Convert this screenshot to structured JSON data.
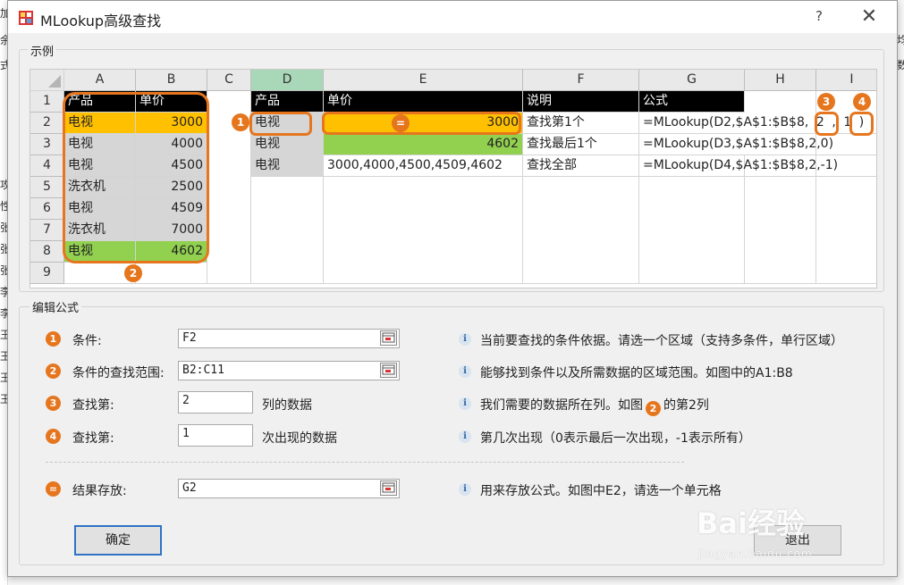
{
  "window": {
    "title": "MLookup高级查找",
    "help": "?",
    "close": "✕"
  },
  "background": {
    "left_chars": [
      "加",
      "余",
      "式",
      "",
      "",
      "",
      "",
      "",
      "攻",
      "性",
      "张",
      "张",
      "张",
      "李",
      "李",
      "王",
      "王",
      "王",
      "王"
    ],
    "right_chars": [
      "均",
      "数"
    ]
  },
  "example_group": {
    "legend": "示例"
  },
  "sheet": {
    "col_headers": [
      "A",
      "B",
      "C",
      "D",
      "E",
      "F",
      "G",
      "H",
      "I"
    ],
    "row_headers": [
      "1",
      "2",
      "3",
      "4",
      "5",
      "6",
      "7",
      "8",
      "9"
    ],
    "cells": {
      "A1": "产品",
      "B1": "单价",
      "A2": "电视",
      "B2": "3000",
      "A3": "电视",
      "B3": "4000",
      "A4": "电视",
      "B4": "4500",
      "A5": "洗衣机",
      "B5": "2500",
      "A6": "电视",
      "B6": "4509",
      "A7": "洗衣机",
      "B7": "7000",
      "A8": "电视",
      "B8": "4602",
      "D1": "产品",
      "E1": "单价",
      "F1": "说明",
      "G1": "公式",
      "D2": "电视",
      "E2": "3000",
      "F2": "查找第1个",
      "G2": "=MLookup(D2,$A$1:$B$8,2,1)",
      "D3": "电视",
      "E3": "4602",
      "F3": "查找最后1个",
      "G3": "=MLookup(D3,$A$1:$B$8,2,0)",
      "D4": "电视",
      "E4": "3000,4000,4500,4509,4602",
      "F4": "查找全部",
      "G4": "=MLookup(D4,$A$1:$B$8,2,-1)",
      "G2_prefix": "=MLookup(D2,$A$1:$B$8,",
      "G2_arg3": "2",
      "G2_comma": ",",
      "G2_arg4": "1",
      "G2_close": ")"
    },
    "badges": {
      "b1": "1",
      "b2": "2",
      "b3": "3",
      "b4": "4",
      "eq": "="
    }
  },
  "edit_group": {
    "legend": "编辑公式"
  },
  "form": {
    "rows": [
      {
        "badge": "1",
        "label": "条件:",
        "value": "F2",
        "info": "当前要查找的条件依据。请选一个区域（支持多条件，单行区域）"
      },
      {
        "badge": "2",
        "label": "条件的查找范围:",
        "value": "B2:C11",
        "info": "能够找到条件以及所需数据的区域范围。如图中的A1:B8"
      },
      {
        "badge": "3",
        "label": "查找第:",
        "value": "2",
        "suffix": "列的数据",
        "info_a": "我们需要的数据所在列。如图",
        "info_badge": "2",
        "info_b": "的第2列"
      },
      {
        "badge": "4",
        "label": "查找第:",
        "value": "1",
        "suffix": "次出现的数据",
        "info": "第几次出现（0表示最后一次出现，-1表示所有）"
      },
      {
        "badge": "=",
        "label": "结果存放:",
        "value": "G2",
        "info": "用来存放公式。如图中E2，请选一个单元格"
      }
    ],
    "info_icon": "i"
  },
  "buttons": {
    "ok": "确定",
    "exit": "退出"
  },
  "watermark": {
    "text": "Bai经验",
    "url": "jingyan.baidu.com"
  },
  "colors": {
    "accent": "#e6761e",
    "yellow": "#ffc000",
    "green": "#92d050",
    "header_selected": "#a8d8b8"
  }
}
